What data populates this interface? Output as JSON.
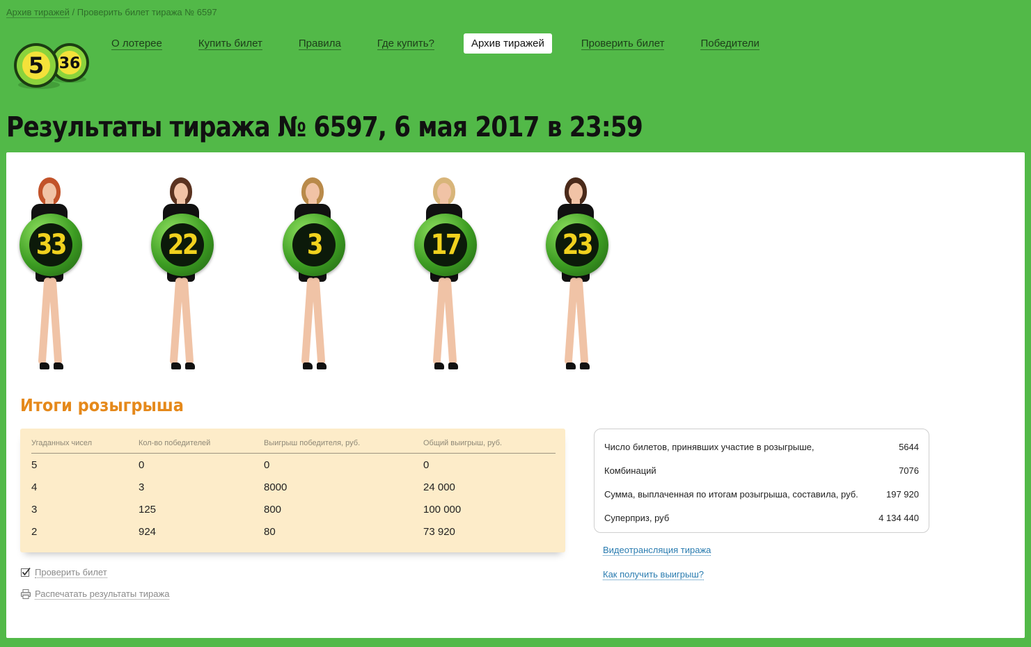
{
  "breadcrumb": {
    "link": "Архив тиражей",
    "separator": " / ",
    "current": "Проверить билет тиража № 6597"
  },
  "logo": {
    "left_number": "5",
    "right_number": "36"
  },
  "nav": {
    "items": [
      {
        "label": "О лотерее",
        "active": false
      },
      {
        "label": "Купить билет",
        "active": false
      },
      {
        "label": "Правила",
        "active": false
      },
      {
        "label": "Где купить?",
        "active": false
      },
      {
        "label": "Архив тиражей",
        "active": true
      },
      {
        "label": "Проверить билет",
        "active": false
      },
      {
        "label": "Победители",
        "active": false
      }
    ]
  },
  "page_title": "Результаты тиража № 6597, 6 мая 2017 в 23:59",
  "drawn_numbers": [
    "33",
    "22",
    "3",
    "17",
    "23"
  ],
  "results": {
    "title": "Итоги розыгрыша",
    "headers": [
      "Угаданных чисел",
      "Кол-во победителей",
      "Выигрыш победителя, руб.",
      "Общий выигрыш, руб."
    ],
    "rows": [
      [
        "5",
        "0",
        "0",
        "0"
      ],
      [
        "4",
        "3",
        "8000",
        "24 000"
      ],
      [
        "3",
        "125",
        "800",
        "100 000"
      ],
      [
        "2",
        "924",
        "80",
        "73 920"
      ]
    ]
  },
  "stats": [
    {
      "label": "Число билетов, принявших участие в розыгрыше,",
      "value": "5644"
    },
    {
      "label": "Комбинаций",
      "value": "7076"
    },
    {
      "label": "Сумма, выплаченная по итогам розыгрыша, составила, руб.",
      "value": "197 920"
    },
    {
      "label": "Суперприз, руб",
      "value": "4 134 440"
    }
  ],
  "links_right": [
    "Видеотрансляция тиража",
    "Как получить выигрыш?"
  ],
  "links_left": {
    "check_ticket": "Проверить билет",
    "print_results": "Распечатать результаты тиража"
  },
  "colors": {
    "background": "#52b948",
    "accent_orange": "#e5891b",
    "table_bg": "#fdecc9",
    "ball_number": "#f1d21e",
    "link_blue": "#2a7cb0"
  },
  "icons": [
    "checkbox-checked-icon",
    "printer-icon"
  ]
}
